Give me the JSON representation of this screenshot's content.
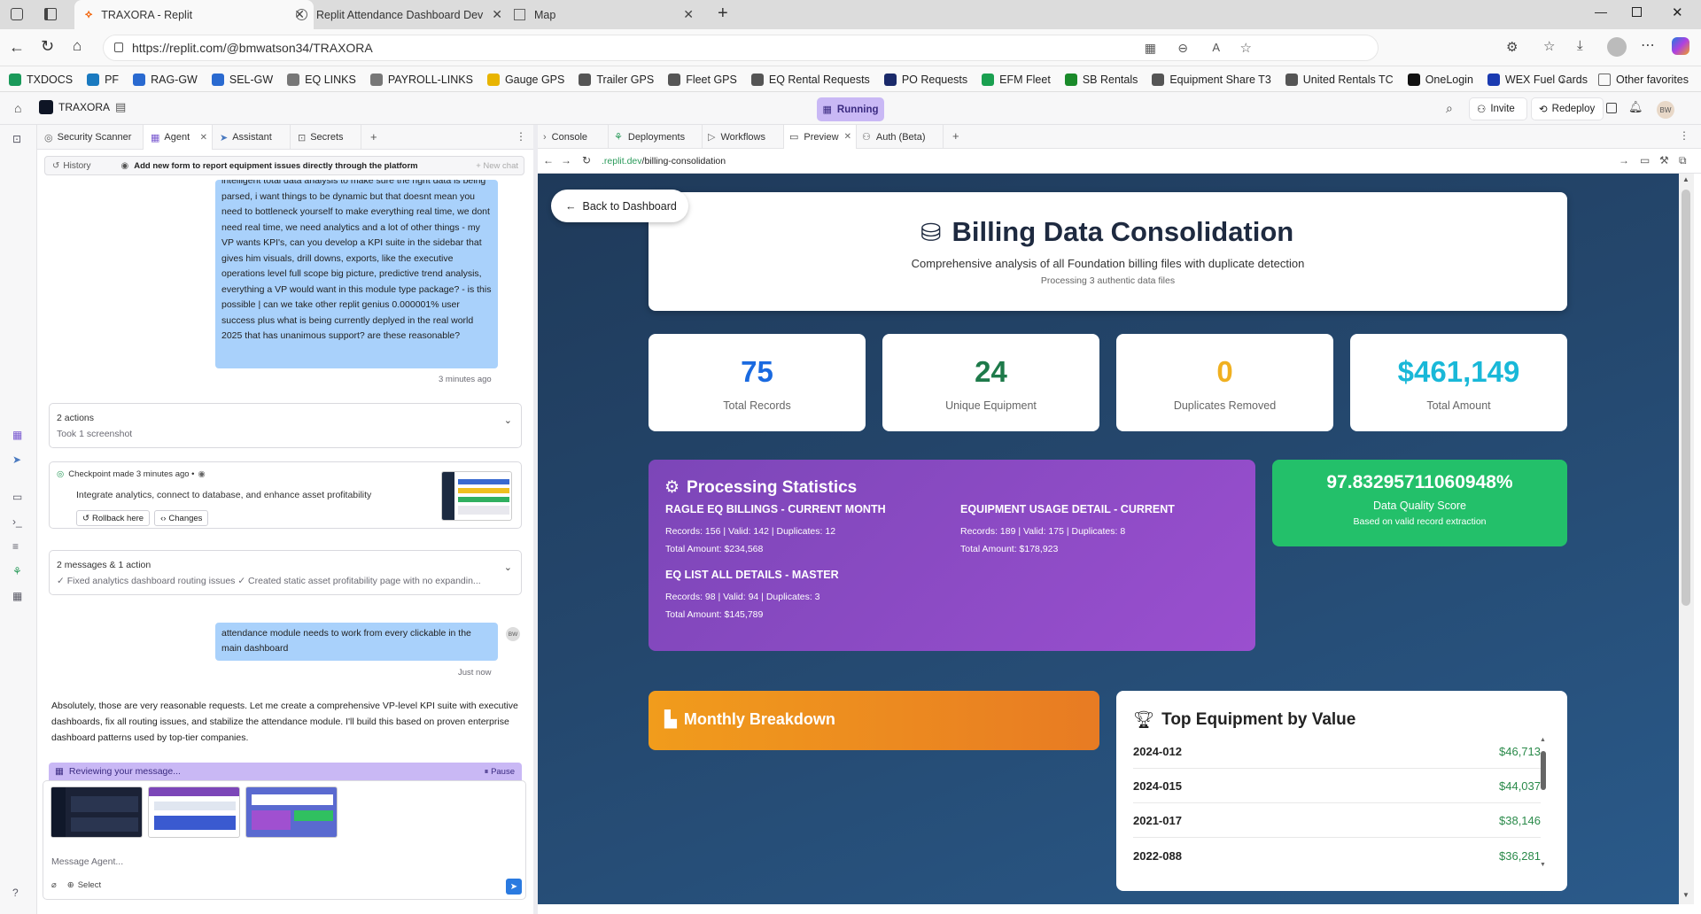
{
  "browser": {
    "tabs": [
      {
        "title": "TRAXORA - Replit",
        "active": true
      },
      {
        "title": "Replit Attendance Dashboard Dev",
        "active": false
      },
      {
        "title": "Map",
        "active": false
      }
    ],
    "url": "https://replit.com/@bmwatson34/TRAXORA",
    "bookmarks": [
      {
        "label": "TXDOCS",
        "color": "#1a9a5a"
      },
      {
        "label": "PF",
        "color": "#1a7ac0"
      },
      {
        "label": "RAG-GW",
        "color": "#2a6ad0"
      },
      {
        "label": "SEL-GW",
        "color": "#2a6ad0"
      },
      {
        "label": "EQ LINKS",
        "color": "#777777"
      },
      {
        "label": "PAYROLL-LINKS",
        "color": "#777777"
      },
      {
        "label": "Gauge GPS",
        "color": "#e8b400"
      },
      {
        "label": "Trailer GPS",
        "color": "#555555"
      },
      {
        "label": "Fleet GPS",
        "color": "#555555"
      },
      {
        "label": "EQ Rental Requests",
        "color": "#555555"
      },
      {
        "label": "PO Requests",
        "color": "#1a2a6a"
      },
      {
        "label": "EFM Fleet",
        "color": "#1aa050"
      },
      {
        "label": "SB Rentals",
        "color": "#1a8a2a"
      },
      {
        "label": "Equipment Share T3",
        "color": "#555555"
      },
      {
        "label": "United Rentals TC",
        "color": "#555555"
      },
      {
        "label": "OneLogin",
        "color": "#111111"
      },
      {
        "label": "WEX Fuel Cards",
        "color": "#1a3ab0"
      }
    ],
    "other_favorites": "Other favorites"
  },
  "replit": {
    "project": "TRAXORA",
    "status": "Running",
    "invite": "Invite",
    "redeploy": "Redeploy",
    "avatar": "BW"
  },
  "agent": {
    "tabs": [
      "Security Scanner",
      "Agent",
      "Assistant",
      "Secrets"
    ],
    "history_label": "History",
    "chat_title": "Add new form to report equipment issues directly through the platform",
    "new_chat": "+ New chat",
    "user_message_1": "intelligent total data analysis to make sure the right data is being parsed, i want things to be dynamic but that doesnt mean you need to bottleneck yourself to make everything real time, we dont need real time, we need analytics and a lot of other things - my VP wants KPI's, can you develop a KPI suite in the sidebar that gives him visuals, drill downs, exports, like the executive operations level full scope big picture, predictive trend analysis, everything a VP would want in this module type package? - is this possible | can we take other replit genius 0.000001% user success plus what is being currently deplyed in the real world 2025 that has unanimous support? are these reasonable?",
    "user_message_1_time": "3 minutes ago",
    "actions_card": {
      "title": "2 actions",
      "subtitle": "Took 1 screenshot"
    },
    "checkpoint": {
      "header": "Checkpoint made 3 minutes ago •",
      "text": "Integrate analytics, connect to database, and enhance asset profitability",
      "rollback": "Rollback here",
      "changes": "Changes"
    },
    "messages_card": {
      "title": "2 messages & 1 action",
      "subtitle": "✓ Fixed analytics dashboard routing issues ✓ Created static asset profitability page with no expandin..."
    },
    "user_message_2": "attendance module needs to work from every clickable in the main dashboard",
    "user_message_2_time": "Just now",
    "user_initials": "BW",
    "reply": "Absolutely, those are very reasonable requests. Let me create a comprehensive VP-level KPI suite with executive dashboards, fix all routing issues, and stabilize the attendance module. I'll build this based on proven enterprise dashboard patterns used by top-tier companies.",
    "reviewing": "Reviewing your message...",
    "pause": "Pause",
    "placeholder": "Message Agent...",
    "select": "Select"
  },
  "preview": {
    "tabs": [
      "Console",
      "Deployments",
      "Workflows",
      "Preview",
      "Auth (Beta)"
    ],
    "url_domain": ".replit.dev",
    "url_path": "/billing-consolidation",
    "back_button": "Back to Dashboard",
    "title": "Billing Data Consolidation",
    "subtitle": "Comprehensive analysis of all Foundation billing files with duplicate detection",
    "processing": "Processing 3 authentic data files",
    "stats": [
      {
        "value": "75",
        "label": "Total Records",
        "color": "#1a6ae0"
      },
      {
        "value": "24",
        "label": "Unique Equipment",
        "color": "#1e7a4a"
      },
      {
        "value": "0",
        "label": "Duplicates Removed",
        "color": "#f0b020"
      },
      {
        "value": "$461,149",
        "label": "Total Amount",
        "color": "#19b8d8"
      }
    ],
    "processing_stats": {
      "title": "Processing Statistics",
      "groups": [
        {
          "name": "RAGLE EQ BILLINGS - CURRENT MONTH",
          "line1": "Records: 156 | Valid: 142 | Duplicates: 12",
          "line2": "Total Amount: $234,568"
        },
        {
          "name": "EQUIPMENT USAGE DETAIL - CURRENT",
          "line1": "Records: 189 | Valid: 175 | Duplicates: 8",
          "line2": "Total Amount: $178,923"
        },
        {
          "name": "EQ LIST ALL DETAILS - MASTER",
          "line1": "Records: 98 | Valid: 94 | Duplicates: 3",
          "line2": "Total Amount: $145,789"
        }
      ]
    },
    "quality": {
      "value": "97.83295711060948%",
      "label": "Data Quality Score",
      "sub": "Based on valid record extraction"
    },
    "monthly_title": "Monthly Breakdown",
    "top_equipment": {
      "title": "Top Equipment by Value",
      "rows": [
        {
          "id": "2024-012",
          "value": "$46,713"
        },
        {
          "id": "2024-015",
          "value": "$44,037"
        },
        {
          "id": "2021-017",
          "value": "$38,146"
        },
        {
          "id": "2022-088",
          "value": "$36,281"
        }
      ]
    }
  }
}
